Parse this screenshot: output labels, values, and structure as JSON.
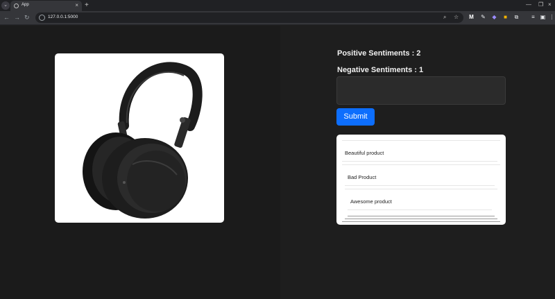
{
  "browser": {
    "tab_title": "App",
    "url": "127.0.0.1:5000"
  },
  "sentiments": {
    "positive_label": "Positive Sentiments : 2",
    "negative_label": "Negative Sentiments : 1"
  },
  "form": {
    "review_value": "",
    "submit_label": "Submit"
  },
  "reviews": [
    "Beautiful product",
    "Bad Product",
    "Awesome product"
  ],
  "icons": {
    "tab": "globe-icon",
    "product": "headphones-image"
  },
  "colors": {
    "accent": "#0d6efd",
    "page_left": "#1b1b1b",
    "page_right": "#1e1e1e"
  }
}
